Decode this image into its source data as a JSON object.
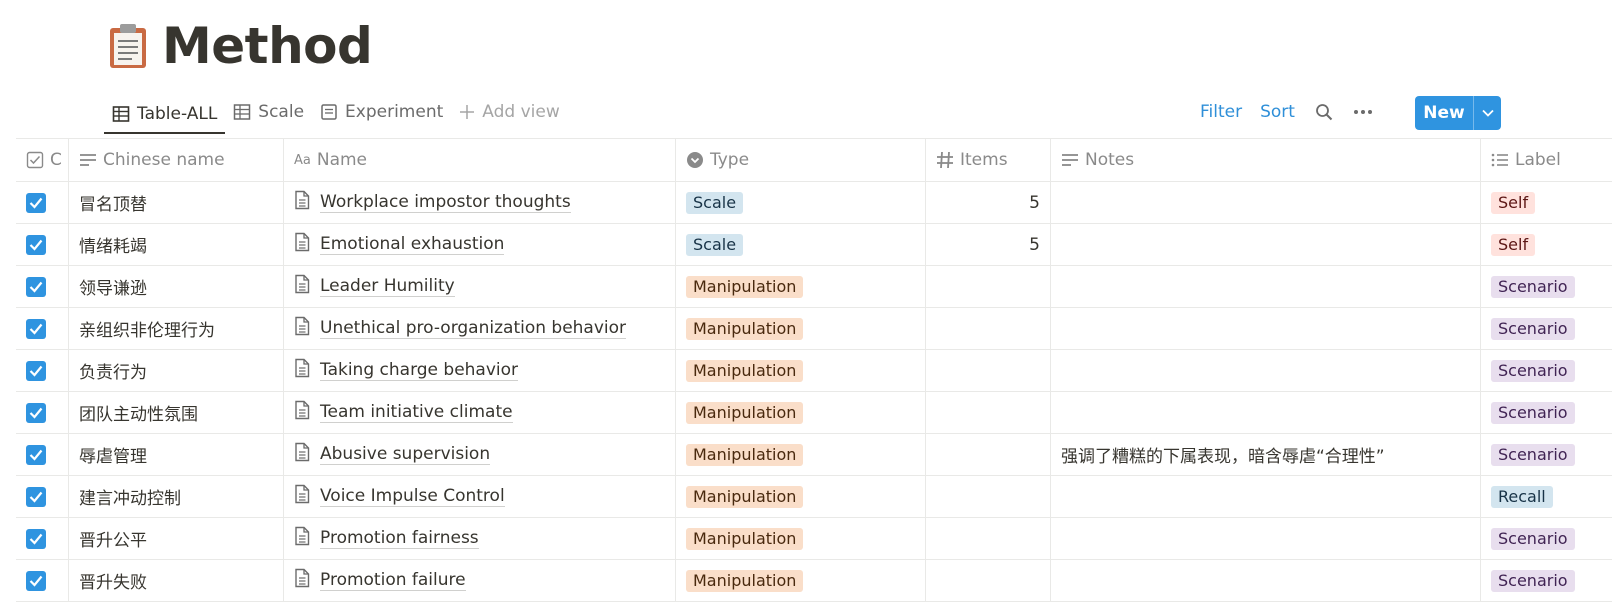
{
  "page": {
    "title": "Method",
    "icon": "clipboard-icon"
  },
  "views": {
    "tabs": [
      {
        "label": "Table-ALL",
        "icon": "table-icon",
        "active": true
      },
      {
        "label": "Scale",
        "icon": "table-icon",
        "active": false
      },
      {
        "label": "Experiment",
        "icon": "list-doc-icon",
        "active": false
      }
    ],
    "add_view": "Add view"
  },
  "toolbar": {
    "filter": "Filter",
    "sort": "Sort",
    "new": "New"
  },
  "table": {
    "columns": {
      "check": "C",
      "chinese": "Chinese name",
      "name": "Name",
      "type": "Type",
      "items": "Items",
      "notes": "Notes",
      "label": "Label"
    },
    "rows": [
      {
        "checked": true,
        "chinese": "冒名顶替",
        "name": "Workplace impostor thoughts",
        "type": "Scale",
        "items": "5",
        "notes": "",
        "label": "Self"
      },
      {
        "checked": true,
        "chinese": "情绪耗竭",
        "name": "Emotional exhaustion",
        "type": "Scale",
        "items": "5",
        "notes": "",
        "label": "Self"
      },
      {
        "checked": true,
        "chinese": "领导谦逊",
        "name": "Leader Humility",
        "type": "Manipulation",
        "items": "",
        "notes": "",
        "label": "Scenario"
      },
      {
        "checked": true,
        "chinese": "亲组织非伦理行为",
        "name": "Unethical pro-organization behavior",
        "type": "Manipulation",
        "items": "",
        "notes": "",
        "label": "Scenario"
      },
      {
        "checked": true,
        "chinese": "负责行为",
        "name": "Taking charge behavior",
        "type": "Manipulation",
        "items": "",
        "notes": "",
        "label": "Scenario"
      },
      {
        "checked": true,
        "chinese": "团队主动性氛围",
        "name": "Team initiative climate",
        "type": "Manipulation",
        "items": "",
        "notes": "",
        "label": "Scenario"
      },
      {
        "checked": true,
        "chinese": "辱虐管理",
        "name": "Abusive supervision",
        "type": "Manipulation",
        "items": "",
        "notes": "强调了糟糕的下属表现，暗含辱虐“合理性”",
        "label": "Scenario"
      },
      {
        "checked": true,
        "chinese": "建言冲动控制",
        "name": "Voice Impulse Control",
        "type": "Manipulation",
        "items": "",
        "notes": "",
        "label": "Recall"
      },
      {
        "checked": true,
        "chinese": "晋升公平",
        "name": "Promotion fairness",
        "type": "Manipulation",
        "items": "",
        "notes": "",
        "label": "Scenario"
      },
      {
        "checked": true,
        "chinese": "晋升失败",
        "name": "Promotion failure",
        "type": "Manipulation",
        "items": "",
        "notes": "",
        "label": "Scenario"
      }
    ]
  },
  "colors": {
    "accent": "#2f94e0",
    "type_tags": {
      "Scale": {
        "bg": "#d3e5ef",
        "fg": "#183347"
      },
      "Manipulation": {
        "bg": "#fadec9",
        "fg": "#49290e"
      }
    },
    "label_tags": {
      "Self": {
        "bg": "#ffe2dd",
        "fg": "#5d1715"
      },
      "Scenario": {
        "bg": "#e8deee",
        "fg": "#412454"
      },
      "Recall": {
        "bg": "#d3e5ef",
        "fg": "#183347"
      }
    }
  }
}
